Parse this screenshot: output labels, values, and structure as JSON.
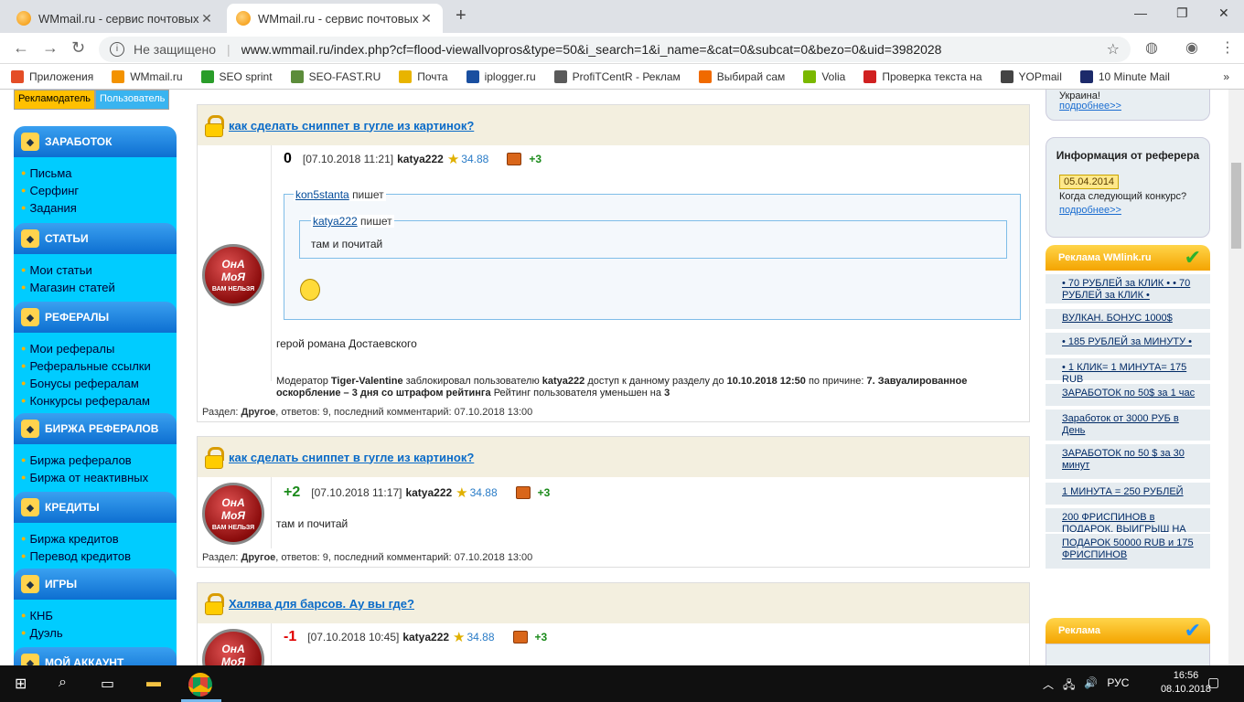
{
  "browser": {
    "tabs": [
      {
        "title": "WMmail.ru - сервис почтовых р",
        "active": false
      },
      {
        "title": "WMmail.ru - сервис почтовых р",
        "active": true
      }
    ],
    "insecure_label": "Не защищено",
    "url": "www.wmmail.ru/index.php?cf=flood-viewallvopros&type=50&i_search=1&i_name=&cat=0&subcat=0&bezo=0&uid=3982028",
    "bookmarks": [
      {
        "label": "Приложения",
        "color": "#e44d26"
      },
      {
        "label": "WMmail.ru",
        "color": "#f39200"
      },
      {
        "label": "SEO sprint",
        "color": "#2a9d2a"
      },
      {
        "label": "SEO-FAST.RU",
        "color": "#5c8c3a"
      },
      {
        "label": "Почта",
        "color": "#e8b400"
      },
      {
        "label": "iplogger.ru",
        "color": "#1a4fa0"
      },
      {
        "label": "ProfiTCentR - Реклам",
        "color": "#5a5a5a"
      },
      {
        "label": "Выбирай сам",
        "color": "#f06a00"
      },
      {
        "label": "Volia",
        "color": "#7ab800"
      },
      {
        "label": "Проверка текста на",
        "color": "#d02020"
      },
      {
        "label": "YOPmail",
        "color": "#444"
      },
      {
        "label": "10 Minute Mail",
        "color": "#1c2a6a"
      }
    ]
  },
  "left_menu": {
    "role_buttons": [
      "Рекламодатель",
      "Пользователь"
    ],
    "sections": [
      {
        "title": "ЗАРАБОТОК",
        "links": [
          "Письма",
          "Серфинг",
          "Задания"
        ]
      },
      {
        "title": "СТАТЬИ",
        "links": [
          "Мои статьи",
          "Магазин статей"
        ]
      },
      {
        "title": "РЕФЕРАЛЫ",
        "links": [
          "Мои рефералы",
          "Реферальные ссылки",
          "Бонусы рефералам",
          "Конкурсы рефералам"
        ]
      },
      {
        "title": "БИРЖА РЕФЕРАЛОВ",
        "links": [
          "Биржа рефералов",
          "Биржа от неактивных"
        ]
      },
      {
        "title": "КРЕДИТЫ",
        "links": [
          "Биржа кредитов",
          "Перевод кредитов"
        ]
      },
      {
        "title": "ИГРЫ",
        "links": [
          "КНБ",
          "Дуэль"
        ]
      },
      {
        "title": "МОЙ АККАУНТ",
        "links": []
      }
    ]
  },
  "avatar_text": {
    "line1": "ОнА",
    "line2": "МоЯ",
    "line3": "ВАМ НЕЛЬЗЯ"
  },
  "posts": [
    {
      "title": "как сделать сниппет в гугле из картинок?",
      "score": "0",
      "datetime": "[07.10.2018 11:21]",
      "author": "katya222",
      "rating": "34.88",
      "karma": "+3",
      "quote_author": "kon5stanta",
      "nested_quote_author": "katya222",
      "writes": "пишет",
      "nested_quote_text": "там и почитай",
      "body": "герой романа Достаевского",
      "moderation": {
        "prefix": "Модератор",
        "moderator": "Tiger-Valentine",
        "middle": "заблокировал пользователю",
        "user": "katya222",
        "middle2": "доступ к данному разделу до",
        "until": "10.10.2018 12:50",
        "reason_prefix": "по причине:",
        "reason": "7. Завуалированное оскорбление – 3 дня со штрафом рейтинга",
        "suffix": "Рейтинг пользователя уменьшен на",
        "amount": "3"
      },
      "footer": {
        "label": "Раздел:",
        "section": "Другое",
        "rest": ", ответов: 9, последний комментарий: 07.10.2018 13:00"
      }
    },
    {
      "title": "как сделать сниппет в гугле из картинок?",
      "score": "+2",
      "datetime": "[07.10.2018 11:17]",
      "author": "katya222",
      "rating": "34.88",
      "karma": "+3",
      "body": "там и почитай",
      "footer": {
        "label": "Раздел:",
        "section": "Другое",
        "rest": ", ответов: 9, последний комментарий: 07.10.2018 13:00"
      }
    },
    {
      "title": "Халява для барсов. Ау вы где?",
      "score": "-1",
      "datetime": "[07.10.2018 10:45]",
      "author": "katya222",
      "rating": "34.88",
      "karma": "+3"
    }
  ],
  "right_bar": {
    "top_partial": "Украина!",
    "more": "подробнее>>",
    "referrer": {
      "title": "Информация от реферера",
      "date": "05.04.2014",
      "text": "Когда следующий конкурс?",
      "more": "подробнее>>"
    },
    "wmlink_title": "Реклама WMlink.ru",
    "ads": [
      "•   70 РУБЛЕЙ  за  КЛИК •   •  70  РУБЛЕЙ  за  КЛИК •",
      "ВУЛКАН. БОНУС 1000$",
      "•   185 РУБЛЕЙ  за  МИНУТУ •",
      "•  1  КЛИК=  1  МИНУТА=  175  RUB",
      "ЗАРАБОТОК по 50$ за 1 час",
      "Заработок от 3000 РУБ в День",
      "ЗАРАБОТОК по 50 $ за 30 минут",
      "1 МИНУТА = 250 РУБЛЕЙ",
      "200 ФРИСПИНОВ в ПОДАРОК. ВЫИГРЫШ НА ВЫВОД",
      "ПОДАРОК 50000 RUB и 175 ФРИСПИНОВ"
    ],
    "ad2_title": "Реклама"
  },
  "taskbar": {
    "lang": "РУС",
    "time": "16:56",
    "date": "08.10.2018"
  }
}
